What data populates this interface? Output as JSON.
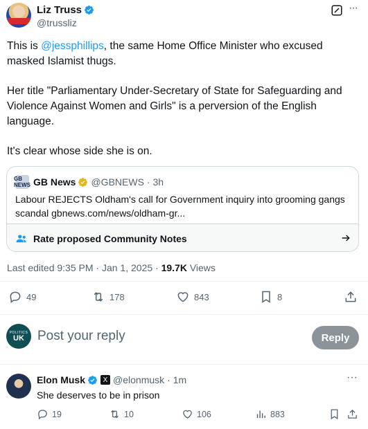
{
  "post": {
    "author_name": "Liz Truss",
    "author_handle": "@trussliz",
    "body": {
      "p1_prefix": "This is ",
      "p1_mention": "@jessphillips",
      "p1_suffix": ", the same Home Office Minister who excused masked Islamist thugs.",
      "p2": "Her title \"Parliamentary Under-Secretary of State for Safeguarding and Violence Against Women and Girls\" is a perversion of the English language.",
      "p3": "It's clear whose side she is on."
    },
    "quote": {
      "logo_text": "GB NEWS",
      "source_name": "GB News",
      "source_handle": "@GBNEWS",
      "time": "· 3h",
      "text": "Labour REJECTS Oldham's call for Government inquiry into grooming gangs scandal gbnews.com/news/oldham-gr...",
      "community_notes_label": "Rate proposed Community Notes"
    },
    "edited_line": "Last edited 9:35 PM · Jan 1, 2025 · ",
    "views_count": "19.7K",
    "views_label": " Views",
    "stats": {
      "replies": "49",
      "reposts": "178",
      "likes": "843",
      "bookmarks": "8"
    }
  },
  "reply_box": {
    "avatar_small": "POLITICS",
    "avatar_big": "UK",
    "placeholder": "Post your reply",
    "button_label": "Reply"
  },
  "reply": {
    "author_name": "Elon Musk",
    "author_handle": "@elonmusk",
    "time": "· 1m",
    "text": "She deserves to be in prison",
    "stats": {
      "replies": "19",
      "reposts": "10",
      "likes": "106",
      "views": "883"
    }
  },
  "colors": {
    "accent": "#1d9bf0",
    "muted": "#536471",
    "reply_button": "#8b9399",
    "gold_badge": "#e2b719"
  }
}
